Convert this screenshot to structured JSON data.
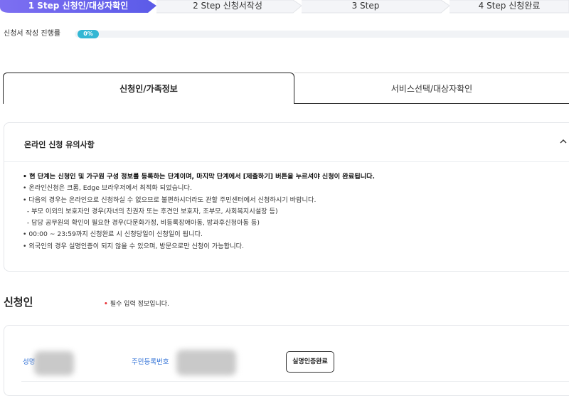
{
  "steps": [
    {
      "label": "1 Step 신청인/대상자확인",
      "active": true
    },
    {
      "label": "2 Step 신청서작성",
      "active": false
    },
    {
      "label": "3 Step",
      "active": false
    },
    {
      "label": "4 Step 신청완료",
      "active": false
    }
  ],
  "progress": {
    "label": "신청서 작성 진행률",
    "value_text": "0%",
    "value_percent": 0
  },
  "tabs": [
    {
      "label": "신청인/가족정보",
      "active": true
    },
    {
      "label": "서비스선택/대상자확인",
      "active": false
    }
  ],
  "notice": {
    "title": "온라인 신청 유의사항",
    "items": [
      "• 현 단계는 신청인 및 가구원 구성 정보를 등록하는 단계이며, 마지막 단계에서 [제출하기] 버튼을 누르셔야 신청이 완료됩니다.",
      "• 온라인신청은 크롬, Edge 브라우저에서 최적화 되었습니다.",
      "• 다음의 경우는 온라인으로 신청하실 수 없으므로 불편하시더라도 관할 주민센터에서 신청하시기 바랍니다.",
      "  - 부모 이외의 보호자인 경우(자녀의 친권자 또는 후견인 보호자, 조부모, 사회복지시설장 등)",
      "  - 담당 공무원의 확인이 필요한 경우(다문화가정, 비등록장애아동, 방과후신청아동 등)",
      "• 00:00 ~ 23:59까지 신청완료 시 신청당일이 신청일이 됩니다.",
      "• 외국인의 경우 실명인증이 되지 않을 수 있으며, 방문으로만 신청이 가능합니다."
    ]
  },
  "applicant": {
    "title": "신청인",
    "required_dot": "•",
    "required_note": "필수 입력 정보입니다.",
    "name_label": "성명",
    "rrn_label": "주민등록번호",
    "verify_button": "실명인증완료"
  },
  "colors": {
    "accent": "#6b62ef",
    "progress": "#33b7d4",
    "field_label": "#2e6fd6",
    "required": "#e8383d"
  }
}
